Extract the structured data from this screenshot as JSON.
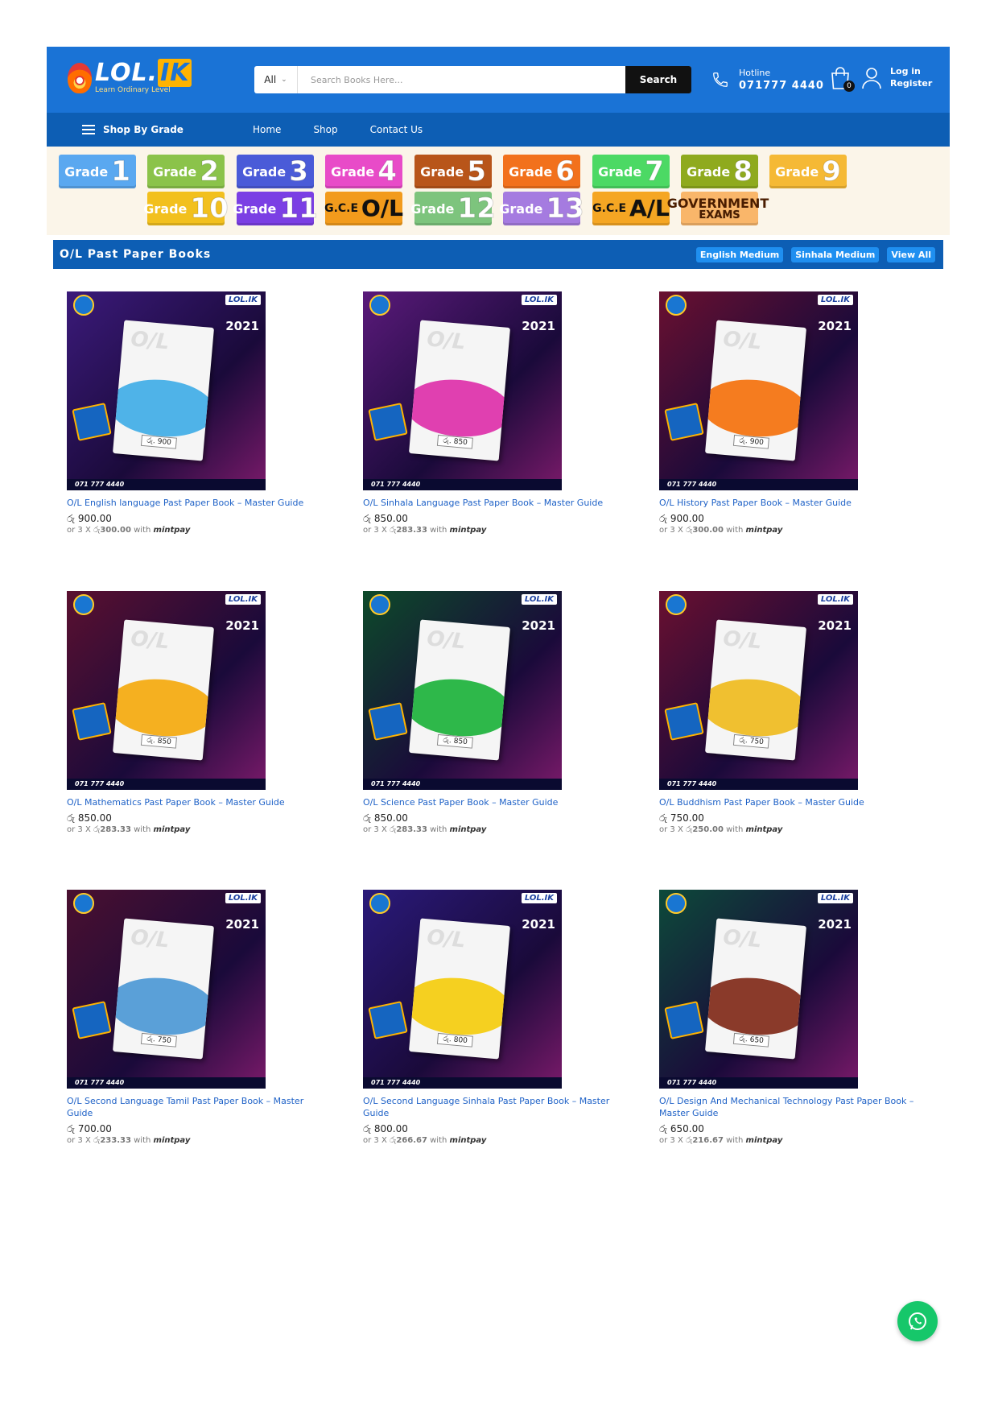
{
  "header": {
    "logo_text": "LOL.",
    "logo_ik": "IK",
    "logo_tagline": "Learn Ordinary Level",
    "search_category": "All",
    "search_placeholder": "Search Books Here...",
    "search_button": "Search",
    "hotline_label": "Hotline",
    "hotline_number": "071777 4440",
    "cart_count": "0",
    "login_label": "Log in",
    "register_label": "Register"
  },
  "nav": {
    "shop_by_grade": "Shop By Grade",
    "links": [
      "Home",
      "Shop",
      "Contact Us"
    ]
  },
  "grades": [
    {
      "word": "Grade",
      "num": "1",
      "color": "#5aa8f0"
    },
    {
      "word": "Grade",
      "num": "2",
      "color": "#8bc34a"
    },
    {
      "word": "Grade",
      "num": "3",
      "color": "#4a5bd8"
    },
    {
      "word": "Grade",
      "num": "4",
      "color": "#e84bc8"
    },
    {
      "word": "Grade",
      "num": "5",
      "color": "#b8551a"
    },
    {
      "word": "Grade",
      "num": "6",
      "color": "#f2711c"
    },
    {
      "word": "Grade",
      "num": "7",
      "color": "#4cd964"
    },
    {
      "word": "Grade",
      "num": "8",
      "color": "#8faa1e"
    },
    {
      "word": "Grade",
      "num": "9",
      "color": "#f5b935"
    },
    {
      "word": "Grade",
      "num": "10",
      "color": "#f2c01e"
    },
    {
      "word": "Grade",
      "num": "11",
      "color": "#7b3fe4"
    },
    {
      "word": "G.C.E",
      "num": "O/L",
      "color": "#f29b1c"
    },
    {
      "word": "Grade",
      "num": "12",
      "color": "#7dc47d"
    },
    {
      "word": "Grade",
      "num": "13",
      "color": "#a57be0"
    },
    {
      "word": "G.C.E",
      "num": "A/L",
      "color": "#f5a623"
    },
    {
      "word": "GOVERNMENT",
      "num": "EXAMS",
      "color": "#f9b66a"
    }
  ],
  "section": {
    "title": "O/L Past Paper Books",
    "filters": [
      "English Medium",
      "Sinhala Medium",
      "View All"
    ]
  },
  "cover_common": {
    "brand": "LOL.IK",
    "year": "2021",
    "phone": "071 777 4440"
  },
  "products": [
    {
      "title": "O/L English language Past Paper Book – Master Guide",
      "price": "රු 900.00",
      "installment_prefix": "or 3 X රු",
      "installment": "300.00",
      "with": "with",
      "mint": "mintpay",
      "tag": "රු. 900",
      "bg": "#3b1a7a",
      "wave": "#4fb3e8"
    },
    {
      "title": "O/L Sinhala Language Past Paper Book – Master Guide",
      "price": "රු 850.00",
      "installment_prefix": "or 3 X රු",
      "installment": "283.33",
      "with": "with",
      "mint": "mintpay",
      "tag": "රු. 850",
      "bg": "#5a1a7a",
      "wave": "#e040b0"
    },
    {
      "title": "O/L History Past Paper Book – Master Guide",
      "price": "රු 900.00",
      "installment_prefix": "or 3 X රු",
      "installment": "300.00",
      "with": "with",
      "mint": "mintpay",
      "tag": "රු. 900",
      "bg": "#6a1030",
      "wave": "#f57c1f"
    },
    {
      "title": "O/L Mathematics Past Paper Book – Master Guide",
      "price": "රු 850.00",
      "installment_prefix": "or 3 X රු",
      "installment": "283.33",
      "with": "with",
      "mint": "mintpay",
      "tag": "රු. 850",
      "bg": "#5a1030",
      "wave": "#f5b020"
    },
    {
      "title": "O/L Science Past Paper Book – Master Guide",
      "price": "රු 850.00",
      "installment_prefix": "or 3 X රු",
      "installment": "283.33",
      "with": "with",
      "mint": "mintpay",
      "tag": "රු. 850",
      "bg": "#0d4a2a",
      "wave": "#2eb84a"
    },
    {
      "title": "O/L Buddhism Past Paper Book – Master Guide",
      "price": "රු 750.00",
      "installment_prefix": "or 3 X රු",
      "installment": "250.00",
      "with": "with",
      "mint": "mintpay",
      "tag": "රු. 750",
      "bg": "#6a1030",
      "wave": "#f0c030"
    },
    {
      "title": "O/L Second Language Tamil Past Paper Book – Master Guide",
      "price": "රු 700.00",
      "installment_prefix": "or 3 X රු",
      "installment": "233.33",
      "with": "with",
      "mint": "mintpay",
      "tag": "රු. 750",
      "bg": "#4a1030",
      "wave": "#5aa0d8"
    },
    {
      "title": "O/L Second Language Sinhala Past Paper Book – Master Guide",
      "price": "රු 800.00",
      "installment_prefix": "or 3 X රු",
      "installment": "266.67",
      "with": "with",
      "mint": "mintpay",
      "tag": "රු. 800",
      "bg": "#2a1a7a",
      "wave": "#f5d020"
    },
    {
      "title": "O/L Design And Mechanical Technology Past Paper Book – Master Guide",
      "price": "රු 650.00",
      "installment_prefix": "or 3 X රු",
      "installment": "216.67",
      "with": "with",
      "mint": "mintpay",
      "tag": "රු. 650",
      "bg": "#0d4a3a",
      "wave": "#8a3a2a"
    }
  ]
}
